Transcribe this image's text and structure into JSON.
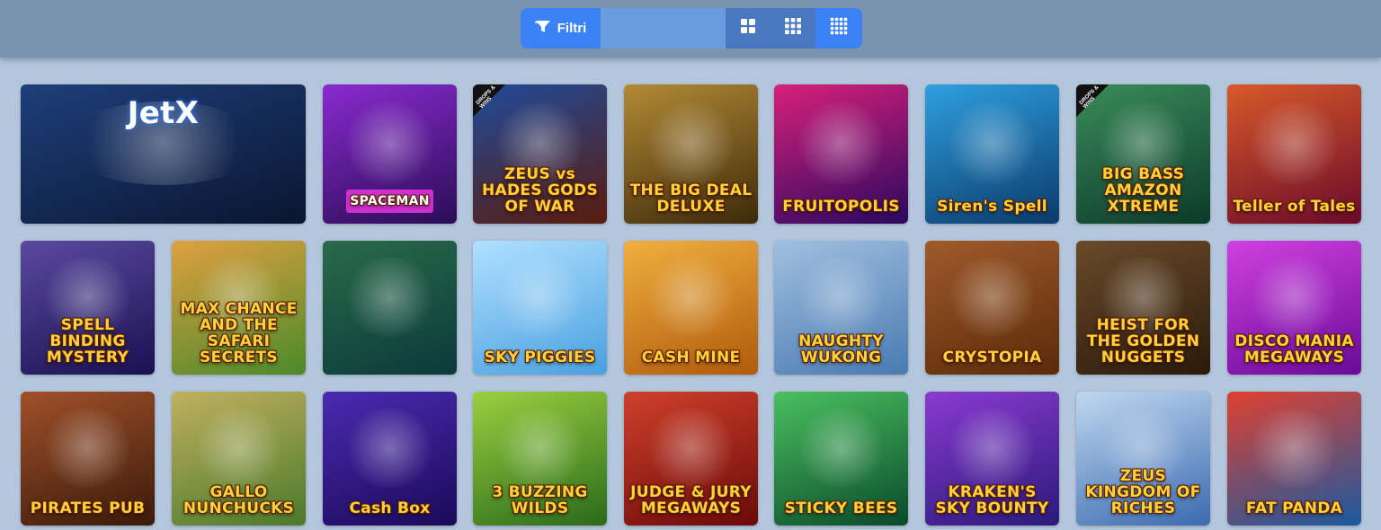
{
  "toolbar": {
    "filter_label": "Filtri",
    "filter_icon": "filter-icon",
    "view_options": [
      "grid-large-icon",
      "grid-medium-icon",
      "grid-small-icon"
    ],
    "active_view": "grid-small-icon"
  },
  "colors": {
    "page_bg": "#b4c6dc",
    "topbar_bg": "#7a94b0",
    "accent": "#3b82f6"
  },
  "games": [
    {
      "title": "JetX",
      "badge": ""
    },
    {
      "title": "SPACEMAN",
      "badge": ""
    },
    {
      "title": "ZEUS vs HADES GODS OF WAR",
      "badge": "DROPS & WINS"
    },
    {
      "title": "THE BIG DEAL DELUXE",
      "badge": ""
    },
    {
      "title": "FRUITOPOLIS",
      "badge": ""
    },
    {
      "title": "Siren's Spell",
      "badge": ""
    },
    {
      "title": "BIG BASS AMAZON XTREME",
      "badge": "DROPS & WINS"
    },
    {
      "title": "Teller of Tales",
      "badge": ""
    },
    {
      "title": "SPELL BINDING MYSTERY",
      "badge": ""
    },
    {
      "title": "MAX CHANCE AND THE SAFARI SECRETS",
      "badge": ""
    },
    {
      "title": "",
      "badge": ""
    },
    {
      "title": "SKY PIGGIES",
      "badge": ""
    },
    {
      "title": "CASH MINE",
      "badge": ""
    },
    {
      "title": "NAUGHTY WUKONG",
      "badge": ""
    },
    {
      "title": "CRYSTOPIA",
      "badge": ""
    },
    {
      "title": "HEIST FOR THE GOLDEN NUGGETS",
      "badge": ""
    },
    {
      "title": "DISCO MANIA MEGAWAYS",
      "badge": ""
    },
    {
      "title": "PIRATES PUB",
      "badge": ""
    },
    {
      "title": "GALLO NUNCHUCKS",
      "badge": ""
    },
    {
      "title": "Cash Box",
      "badge": ""
    },
    {
      "title": "3 BUZZING WILDS",
      "badge": ""
    },
    {
      "title": "JUDGE & JURY MEGAWAYS",
      "badge": ""
    },
    {
      "title": "STICKY BEES",
      "badge": ""
    },
    {
      "title": "KRAKEN'S SKY BOUNTY",
      "badge": ""
    },
    {
      "title": "ZEUS KINGDOM OF RICHES",
      "badge": ""
    },
    {
      "title": "FAT PANDA",
      "badge": ""
    }
  ]
}
